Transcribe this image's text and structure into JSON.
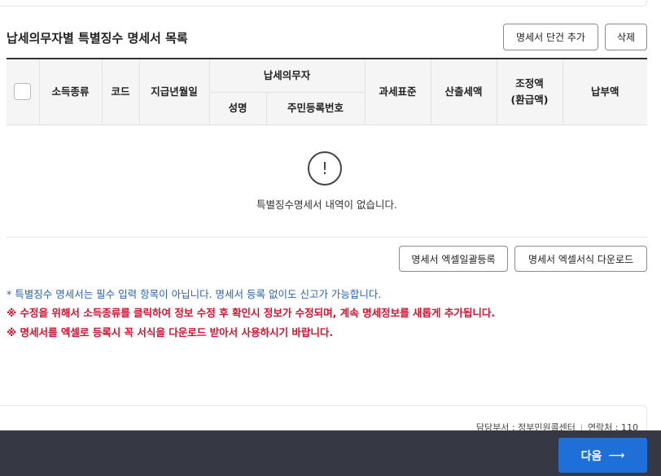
{
  "section": {
    "title": "납세의무자별 특별징수 명세서 목록",
    "add_button": "명세서 단건 추가",
    "delete_button": "삭제"
  },
  "table": {
    "headers": {
      "income_type": "소득종류",
      "code": "코드",
      "payment_date": "지급년월일",
      "taxpayer_group": "납세의무자",
      "name": "성명",
      "resident_number": "주민등록번호",
      "tax_base": "과세표준",
      "calculated_tax": "산출세액",
      "adjusted_amount_line1": "조정액",
      "adjusted_amount_line2": "(환급액)",
      "payment_amount": "납부액"
    },
    "rows": [],
    "empty_message": "특별징수명세서 내역이 없습니다."
  },
  "actions": {
    "excel_upload": "명세서 엑셀일괄등록",
    "excel_template_download": "명세서 엑셀서식 다운로드"
  },
  "notes": {
    "info": "* 특별징수 명세서는 필수 입력 항목이 아닙니다. 명세서 등록 없이도 신고가 가능합니다.",
    "warning1": "※ 수정을 위해서 소득종류를 클릭하여 정보 수정 후 확인시 정보가 수정되며, 계속 명세정보를 새롭게 추가됩니다.",
    "warning2": "※ 명세서를 엑셀로 등록시 꼭 서식을 다운로드 받아서 사용하시기 바랍니다."
  },
  "footer": {
    "department": "담당부서 : 정부민원콜센터",
    "contact": "연락처 : 110"
  },
  "navigation": {
    "next_label": "다음",
    "next_arrow": "⟶"
  },
  "colors": {
    "primary": "#1f6fd8",
    "bottom_bar": "#363944",
    "info_text": "#2a64b5",
    "warning_text": "#d1132f"
  },
  "icons": {
    "empty_state": "alert-circle-icon",
    "next": "arrow-right-icon"
  }
}
